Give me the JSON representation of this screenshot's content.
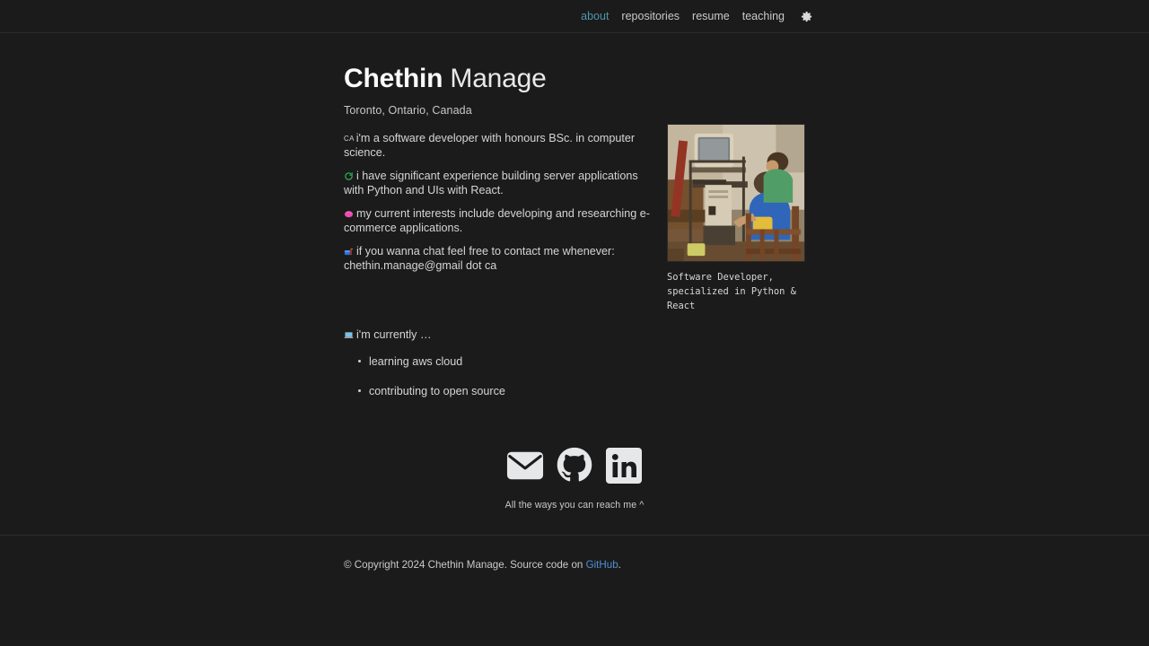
{
  "theme": {
    "background": "#1b1b1b",
    "text": "#d4d5d6",
    "accent_nav": "#4e95a8",
    "accent_link": "#4f8fd6",
    "divider": "#2c2c2c"
  },
  "nav": {
    "items": [
      {
        "label": "about",
        "active": true
      },
      {
        "label": "repositories",
        "active": false
      },
      {
        "label": "resume",
        "active": false
      },
      {
        "label": "teaching",
        "active": false
      }
    ],
    "settings_icon": "gear-icon"
  },
  "hero": {
    "first_name": "Chethin",
    "last_name": "Manage",
    "location": "Toronto, Ontario, Canada"
  },
  "bio": {
    "paragraphs": [
      {
        "icon": "flag-canada-icon",
        "icon_text": "CA",
        "text": "i'm a software developer with honours BSc. in computer science."
      },
      {
        "icon": "recycle-green-icon",
        "text": "i have significant experience building server applications with Python and UIs with React."
      },
      {
        "icon": "brain-pink-icon",
        "text": "my current interests include developing and researching e-commerce applications."
      },
      {
        "icon": "mailbox-blue-icon",
        "text": "if you wanna chat feel free to contact me whenever: chethin.manage@gmail dot ca"
      }
    ]
  },
  "currently": {
    "icon": "laptop-icon",
    "heading": "i'm currently …",
    "items": [
      "learning aws cloud",
      "contributing to open source"
    ]
  },
  "photo": {
    "alt_name": "childhood-computer-photo",
    "caption": "Software Developer,\nspecialized in Python &\nReact"
  },
  "socials": {
    "items": [
      {
        "name": "email-icon",
        "label": "Email"
      },
      {
        "name": "github-icon",
        "label": "GitHub"
      },
      {
        "name": "linkedin-icon",
        "label": "LinkedIn"
      }
    ],
    "note": "All the ways you can reach me ^"
  },
  "footer": {
    "text_before": "© Copyright 2024 Chethin Manage. Source code on ",
    "link_label": "GitHub",
    "text_after": "."
  }
}
